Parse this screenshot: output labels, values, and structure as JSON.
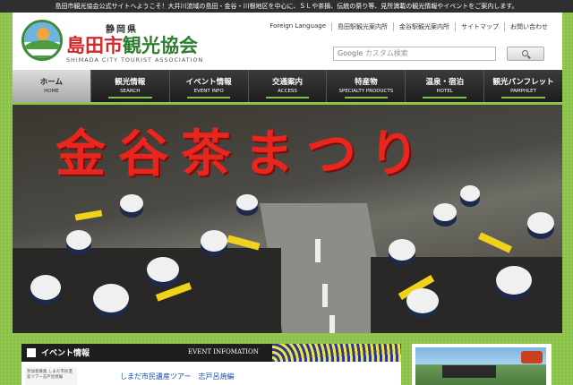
{
  "top_bar": {
    "text": "島田市観光協会公式サイトへようこそ！大井川流域の島田・金谷・川根地区を中心に、ＳＬや茶摘、伝統の祭り等、見所満載の観光情報やイベントをご案内します。"
  },
  "logo": {
    "prefecture": "静岡県",
    "title_part1": "島田市",
    "title_part2": "観光協会",
    "english": "SHIMADA CITY TOURIST ASSOCIATION"
  },
  "utility_links": [
    "Foreign Language",
    "島田駅観光案内所",
    "金谷駅観光案内所",
    "サイトマップ",
    "お問い合わせ"
  ],
  "search": {
    "placeholder_brand": "Google",
    "placeholder": "カスタム検索"
  },
  "nav": [
    {
      "label": "ホーム",
      "sub": "HOME"
    },
    {
      "label": "観光情報",
      "sub": "SEARCH"
    },
    {
      "label": "イベント情報",
      "sub": "EVENT INFO"
    },
    {
      "label": "交通案内",
      "sub": "ACCESS"
    },
    {
      "label": "特産物",
      "sub": "SPECIALTY PRODUCTS"
    },
    {
      "label": "温泉・宿泊",
      "sub": "HOTEL"
    },
    {
      "label": "観光パンフレット",
      "sub": "PAMPHLET"
    }
  ],
  "hero": {
    "title": "金谷茶まつり"
  },
  "events": {
    "title": "イベント情報",
    "title_en": "EVENT INFOMATION",
    "thumb_text": "参加者募集 しまだ市民遺産ツアー志戸呂焼編",
    "link": "しまだ市民遺産ツアー　志戸呂焼編"
  },
  "colors": {
    "accent_green": "#7cc242",
    "title_red": "#d7262a",
    "title_green": "#2e7d32",
    "link_blue": "#1a4fb5"
  }
}
